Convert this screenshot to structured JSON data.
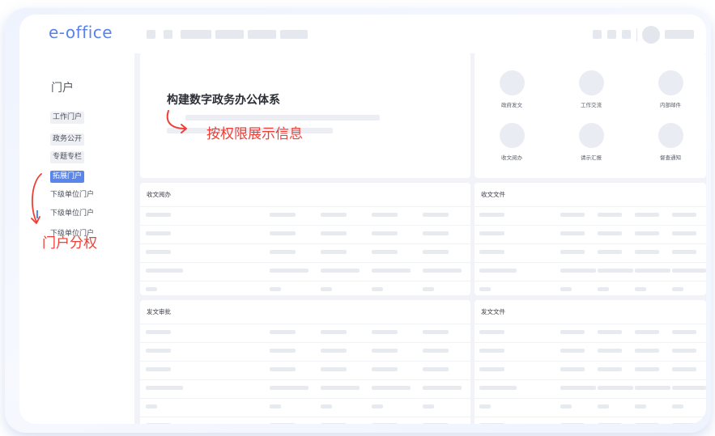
{
  "app": {
    "logo": "e-office"
  },
  "sidebar": {
    "title": "门户",
    "items": [
      {
        "label": "工作门户",
        "active": false
      },
      {
        "label": "政务公开",
        "active": false
      },
      {
        "label": "专题专栏",
        "active": false
      },
      {
        "label": "拓展门户",
        "active": true
      },
      {
        "label": "下级单位门户",
        "active": false
      },
      {
        "label": "下级单位门户",
        "active": false
      },
      {
        "label": "下级单位门户",
        "active": false
      }
    ]
  },
  "hero": {
    "title": "构建数字政务办公体系",
    "annotation": "按权限展示信息"
  },
  "sidebar_annotation": "门户分权",
  "shortcuts": [
    {
      "label": "政府发文",
      "icon": "circle-icon"
    },
    {
      "label": "工作交流",
      "icon": "circle-icon"
    },
    {
      "label": "内部邮件",
      "icon": "circle-icon"
    },
    {
      "label": "收文阅办",
      "icon": "circle-icon"
    },
    {
      "label": "请示汇报",
      "icon": "circle-icon"
    },
    {
      "label": "督查通知",
      "icon": "circle-icon"
    }
  ],
  "panels": {
    "receive_read": {
      "title": "收文阅办"
    },
    "receive_files": {
      "title": "收文文件"
    },
    "send_approval": {
      "title": "发文审批"
    },
    "send_files": {
      "title": "发文文件"
    }
  },
  "colors": {
    "accent": "#5a86ec",
    "logo": "#5b82e8",
    "annotation_red": "#ee3f36",
    "background": "#f1f3f8"
  }
}
